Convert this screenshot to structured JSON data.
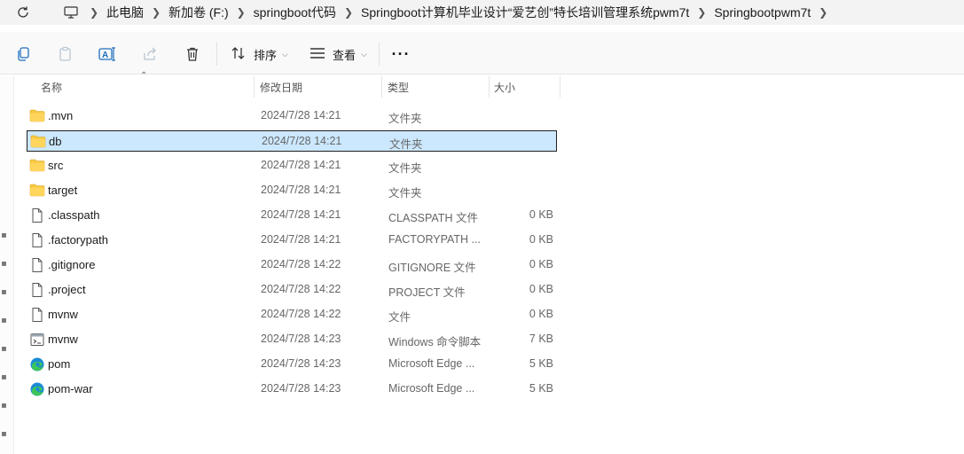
{
  "address": {
    "crumbs": [
      "此电脑",
      "新加卷 (F:)",
      "springboot代码",
      "Springboot计算机毕业设计“爱艺创”特长培训管理系统pwm7t",
      "Springbootpwm7t"
    ]
  },
  "toolbar": {
    "sort_label": "排序",
    "view_label": "查看",
    "more_label": "···"
  },
  "columns": {
    "name": "名称",
    "date": "修改日期",
    "type": "类型",
    "size": "大小"
  },
  "files": [
    {
      "name": ".mvn",
      "date": "2024/7/28 14:21",
      "type": "文件夹",
      "size": "",
      "icon": "folder-icon"
    },
    {
      "name": "db",
      "date": "2024/7/28 14:21",
      "type": "文件夹",
      "size": "",
      "icon": "folder-icon",
      "selected": true
    },
    {
      "name": "src",
      "date": "2024/7/28 14:21",
      "type": "文件夹",
      "size": "",
      "icon": "folder-icon"
    },
    {
      "name": "target",
      "date": "2024/7/28 14:21",
      "type": "文件夹",
      "size": "",
      "icon": "folder-icon"
    },
    {
      "name": ".classpath",
      "date": "2024/7/28 14:21",
      "type": "CLASSPATH 文件",
      "size": "0 KB",
      "icon": "file-icon"
    },
    {
      "name": ".factorypath",
      "date": "2024/7/28 14:21",
      "type": "FACTORYPATH ...",
      "size": "0 KB",
      "icon": "file-icon"
    },
    {
      "name": ".gitignore",
      "date": "2024/7/28 14:22",
      "type": "GITIGNORE 文件",
      "size": "0 KB",
      "icon": "file-icon"
    },
    {
      "name": ".project",
      "date": "2024/7/28 14:22",
      "type": "PROJECT 文件",
      "size": "0 KB",
      "icon": "file-icon"
    },
    {
      "name": "mvnw",
      "date": "2024/7/28 14:22",
      "type": "文件",
      "size": "0 KB",
      "icon": "file-icon"
    },
    {
      "name": "mvnw",
      "date": "2024/7/28 14:23",
      "type": "Windows 命令脚本",
      "size": "7 KB",
      "icon": "script-icon"
    },
    {
      "name": "pom",
      "date": "2024/7/28 14:23",
      "type": "Microsoft Edge ...",
      "size": "5 KB",
      "icon": "edge-icon"
    },
    {
      "name": "pom-war",
      "date": "2024/7/28 14:23",
      "type": "Microsoft Edge ...",
      "size": "5 KB",
      "icon": "edge-icon"
    }
  ],
  "colors": {
    "selection": "#cce8ff",
    "folder": "#f8c942",
    "accent": "#0067c0"
  }
}
